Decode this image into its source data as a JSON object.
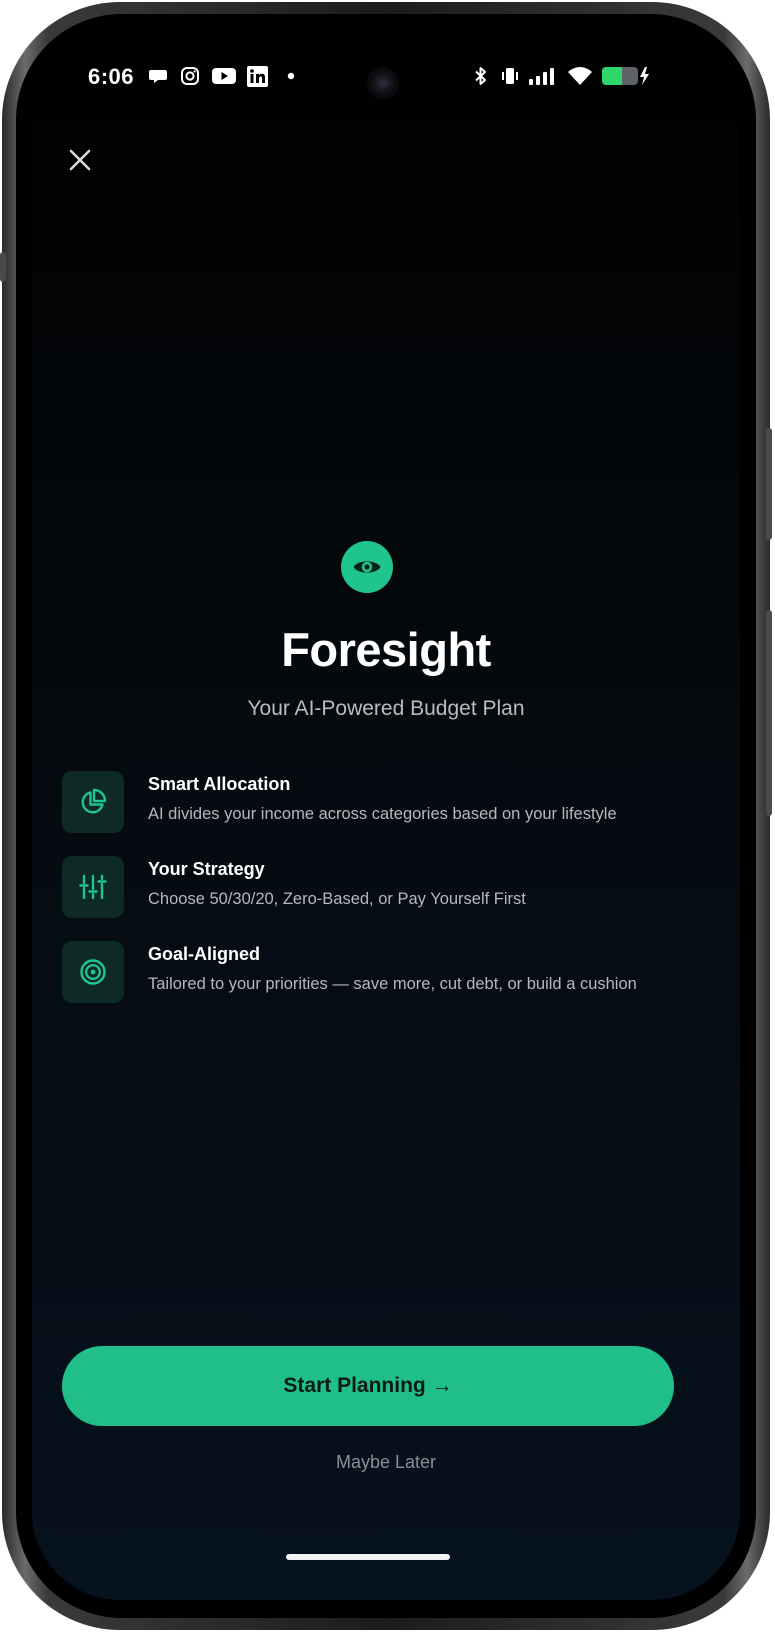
{
  "status_bar": {
    "time": "6:06",
    "notification_icons": [
      "chat-bubble-icon",
      "instagram-icon",
      "youtube-icon",
      "linkedin-icon",
      "dot-icon"
    ],
    "system_icons": [
      "bluetooth-icon",
      "vibrate-icon",
      "signal-icon",
      "wifi-icon",
      "battery-charging-icon"
    ]
  },
  "header": {
    "close_icon": "close-icon"
  },
  "hero": {
    "logo_icon": "eye-icon",
    "title": "Foresight",
    "subtitle": "Your AI-Powered Budget Plan"
  },
  "features": [
    {
      "icon": "pie-chart-icon",
      "title": "Smart Allocation",
      "description": "AI divides your income across categories based on your lifestyle"
    },
    {
      "icon": "sliders-icon",
      "title": "Your Strategy",
      "description": "Choose 50/30/20, Zero-Based, or Pay Yourself First"
    },
    {
      "icon": "target-icon",
      "title": "Goal-Aligned",
      "description": "Tailored to your priorities — save more, cut debt, or build a cushion"
    }
  ],
  "actions": {
    "primary_label": "Start Planning →",
    "secondary_label": "Maybe Later"
  },
  "colors": {
    "accent": "#20C58E",
    "icon_tile": "#0D2A26",
    "background_top": "#000000",
    "background_bottom": "#06121E",
    "battery": "#2FD66A"
  }
}
